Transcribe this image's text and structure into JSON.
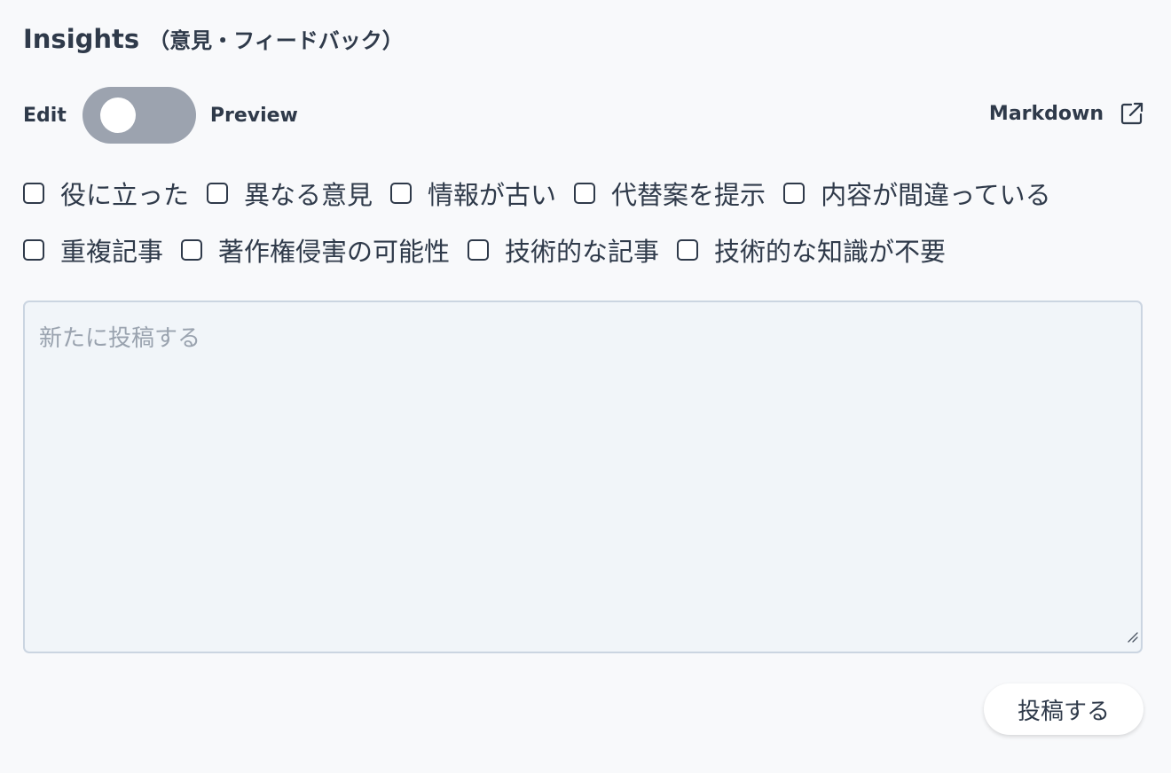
{
  "header": {
    "title": "Insights",
    "subtitle": "（意見・フィードバック）"
  },
  "mode_toggle": {
    "left_label": "Edit",
    "right_label": "Preview",
    "state": "Edit"
  },
  "markdown_link": {
    "label": "Markdown",
    "icon": "external-link-icon"
  },
  "tags": {
    "row1": [
      "役に立った",
      "異なる意見",
      "情報が古い",
      "代替案を提示",
      "内容が間違っている"
    ],
    "row2": [
      "重複記事",
      "著作権侵害の可能性",
      "技術的な記事",
      "技術的な知識が不要"
    ]
  },
  "editor": {
    "value": "",
    "placeholder": "新たに投稿する"
  },
  "submit": {
    "label": "投稿する"
  },
  "colors": {
    "background": "#f8f9fb",
    "text": "#2f3a4a",
    "toggle_track": "#9ca3af",
    "textarea_bg": "#f1f5f9",
    "textarea_border": "#cbd5e1",
    "placeholder": "#9aa3af"
  }
}
